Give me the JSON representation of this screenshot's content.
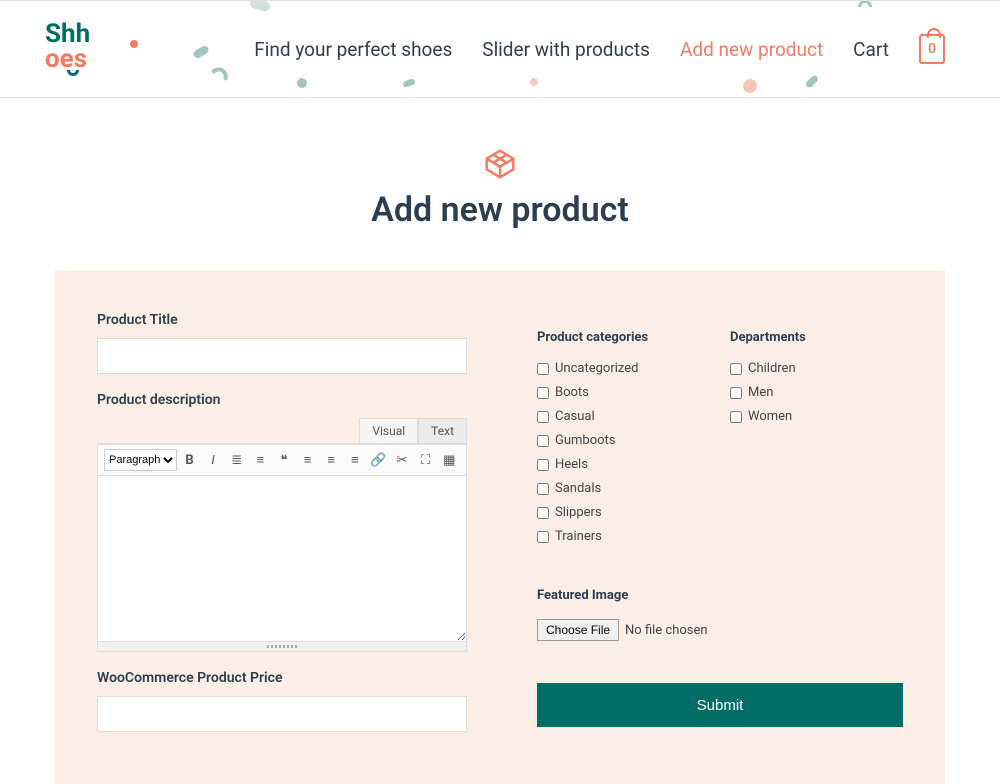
{
  "logo": {
    "line1": "Shh",
    "line2": "oes"
  },
  "nav": {
    "find": "Find your perfect shoes",
    "slider": "Slider with products",
    "add": "Add new product",
    "cart": "Cart",
    "cart_count": "0"
  },
  "hero": {
    "title": "Add new product"
  },
  "form": {
    "title_label": "Product Title",
    "title_value": "",
    "desc_label": "Product description",
    "price_label": "WooCommerce Product Price",
    "price_value": ""
  },
  "editor": {
    "tab_visual": "Visual",
    "tab_text": "Text",
    "paragraph": "Paragraph",
    "content": ""
  },
  "categories": {
    "title": "Product categories",
    "items": [
      "Uncategorized",
      "Boots",
      "Casual",
      "Gumboots",
      "Heels",
      "Sandals",
      "Slippers",
      "Trainers"
    ]
  },
  "departments": {
    "title": "Departments",
    "items": [
      "Children",
      "Men",
      "Women"
    ]
  },
  "featured": {
    "title": "Featured Image",
    "choose": "Choose File",
    "nofile": "No file chosen"
  },
  "submit": "Submit"
}
